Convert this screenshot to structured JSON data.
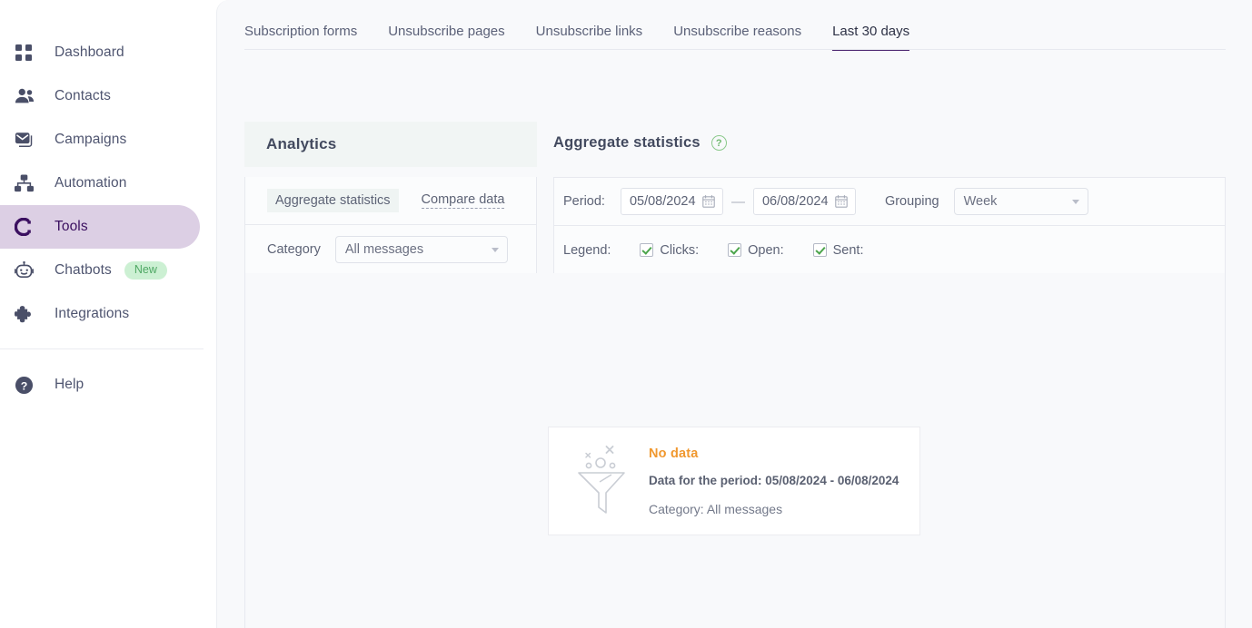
{
  "sidebar": {
    "items": [
      {
        "label": "Dashboard",
        "icon": "grid-icon",
        "active": false,
        "badge": null
      },
      {
        "label": "Contacts",
        "icon": "people-icon",
        "active": false,
        "badge": null
      },
      {
        "label": "Campaigns",
        "icon": "envelope-icon",
        "active": false,
        "badge": null
      },
      {
        "label": "Automation",
        "icon": "sitemap-icon",
        "active": false,
        "badge": null
      },
      {
        "label": "Tools",
        "icon": "tools-c-icon",
        "active": true,
        "badge": null
      },
      {
        "label": "Chatbots",
        "icon": "robot-icon",
        "active": false,
        "badge": "New"
      },
      {
        "label": "Integrations",
        "icon": "puzzle-icon",
        "active": false,
        "badge": null
      },
      {
        "label": "Help",
        "icon": "question-circle-icon",
        "active": false,
        "badge": null
      }
    ],
    "active_color": "#dccfe4",
    "active_text_color": "#3b1060",
    "badge_color": "#4fa864",
    "badge_bg": "#ccf0d3"
  },
  "tabs": [
    {
      "label": "Subscription forms",
      "active": false
    },
    {
      "label": "Unsubscribe pages",
      "active": false
    },
    {
      "label": "Unsubscribe links",
      "active": false
    },
    {
      "label": "Unsubscribe reasons",
      "active": false
    },
    {
      "label": "Last 30 days",
      "active": true
    }
  ],
  "left_panel": {
    "title": "Analytics",
    "segment_active": "Aggregate statistics",
    "segment_link": "Compare data",
    "category_label": "Category",
    "category_value": "All messages"
  },
  "right_panel": {
    "title": "Aggregate statistics",
    "help_icon": "?",
    "period_label": "Period:",
    "date_from": "05/08/2024",
    "date_to": "06/08/2024",
    "date_separator": "—",
    "grouping_label": "Grouping",
    "grouping_value": "Week",
    "legend_label": "Legend:",
    "legend_items": [
      {
        "label": "Clicks:",
        "checked": true
      },
      {
        "label": "Open:",
        "checked": true
      },
      {
        "label": "Sent:",
        "checked": true
      }
    ]
  },
  "no_data": {
    "icon": "funnel-empty-icon",
    "title": "No data",
    "period_line": "Data for the period: 05/08/2024 - 06/08/2024",
    "category_line": "Category: All messages",
    "title_color": "#f0982f"
  }
}
